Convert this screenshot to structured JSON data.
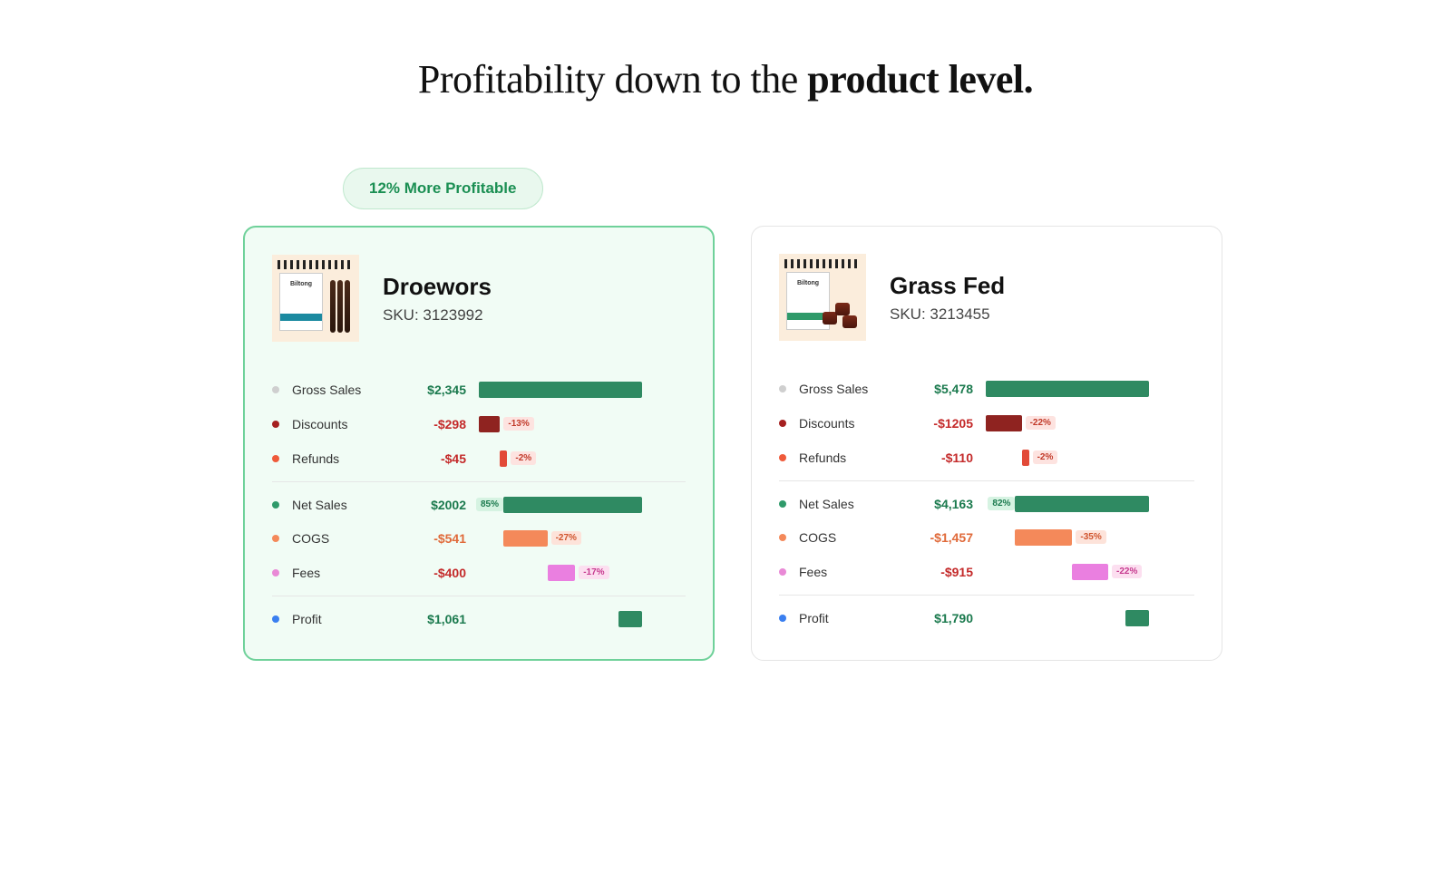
{
  "heading_plain": "Profitability down to the ",
  "heading_bold": "product level.",
  "badge": "12% More Profitable",
  "row_labels": {
    "gross_sales": "Gross Sales",
    "discounts": "Discounts",
    "refunds": "Refunds",
    "net_sales": "Net Sales",
    "cogs": "COGS",
    "fees": "Fees",
    "profit": "Profit"
  },
  "colors": {
    "gross_sales_dot": "#cfcfcf",
    "discounts_dot": "#a52020",
    "refunds_dot": "#ef5a3a",
    "net_sales_dot": "#2f9a6a",
    "cogs_dot": "#f4895a",
    "fees_dot": "#e989d6",
    "profit_dot": "#3a7ff0",
    "bar_green": "#2f8a62",
    "bar_darkred": "#8f2320",
    "bar_red": "#e24a38",
    "bar_orange": "#f4895a",
    "bar_pink": "#ea7fe0",
    "pack_band_a": "#1b8aa0",
    "pack_band_b": "#2f9a6a"
  },
  "products": [
    {
      "id": "droewors",
      "name": "Droewors",
      "sku_label": "SKU: 3123992",
      "highlight": true,
      "thumb_variant": "sticks",
      "metrics": {
        "gross_sales": {
          "text": "$2,345",
          "value": 2345
        },
        "discounts": {
          "text": "-$298",
          "value": -298,
          "pct": "-13%"
        },
        "refunds": {
          "text": "-$45",
          "value": -45,
          "pct": "-2%"
        },
        "net_sales": {
          "text": "$2002",
          "value": 2002,
          "pct": "85%"
        },
        "cogs": {
          "text": "-$541",
          "value": -541,
          "pct": "-27%"
        },
        "fees": {
          "text": "-$400",
          "value": -400,
          "pct": "-17%"
        },
        "profit": {
          "text": "$1,061",
          "value": 1061
        }
      }
    },
    {
      "id": "grassfed",
      "name": "Grass Fed",
      "sku_label": "SKU: 3213455",
      "highlight": false,
      "thumb_variant": "chunks",
      "metrics": {
        "gross_sales": {
          "text": "$5,478",
          "value": 5478
        },
        "discounts": {
          "text": "-$1205",
          "value": -1205,
          "pct": "-22%"
        },
        "refunds": {
          "text": "-$110",
          "value": -110,
          "pct": "-2%"
        },
        "net_sales": {
          "text": "$4,163",
          "value": 4163,
          "pct": "82%"
        },
        "cogs": {
          "text": "-$1,457",
          "value": -1457,
          "pct": "-35%"
        },
        "fees": {
          "text": "-$915",
          "value": -915,
          "pct": "-22%"
        },
        "profit": {
          "text": "$1,790",
          "value": 1790
        }
      }
    }
  ],
  "chart_data": [
    {
      "type": "bar",
      "title": "Droewors – profitability waterfall",
      "orientation": "horizontal",
      "categories": [
        "Gross Sales",
        "Discounts",
        "Refunds",
        "Net Sales",
        "COGS",
        "Fees",
        "Profit"
      ],
      "values": [
        2345,
        -298,
        -45,
        2002,
        -541,
        -400,
        1061
      ],
      "pct_of_gross": [
        null,
        -13,
        -2,
        85,
        -27,
        -17,
        null
      ],
      "colors": [
        "#2f8a62",
        "#8f2320",
        "#e24a38",
        "#2f8a62",
        "#f4895a",
        "#ea7fe0",
        "#2f8a62"
      ]
    },
    {
      "type": "bar",
      "title": "Grass Fed – profitability waterfall",
      "orientation": "horizontal",
      "categories": [
        "Gross Sales",
        "Discounts",
        "Refunds",
        "Net Sales",
        "COGS",
        "Fees",
        "Profit"
      ],
      "values": [
        5478,
        -1205,
        -110,
        4163,
        -1457,
        -915,
        1790
      ],
      "pct_of_gross": [
        null,
        -22,
        -2,
        82,
        -35,
        -22,
        null
      ],
      "colors": [
        "#2f8a62",
        "#8f2320",
        "#e24a38",
        "#2f8a62",
        "#f4895a",
        "#ea7fe0",
        "#2f8a62"
      ]
    }
  ]
}
